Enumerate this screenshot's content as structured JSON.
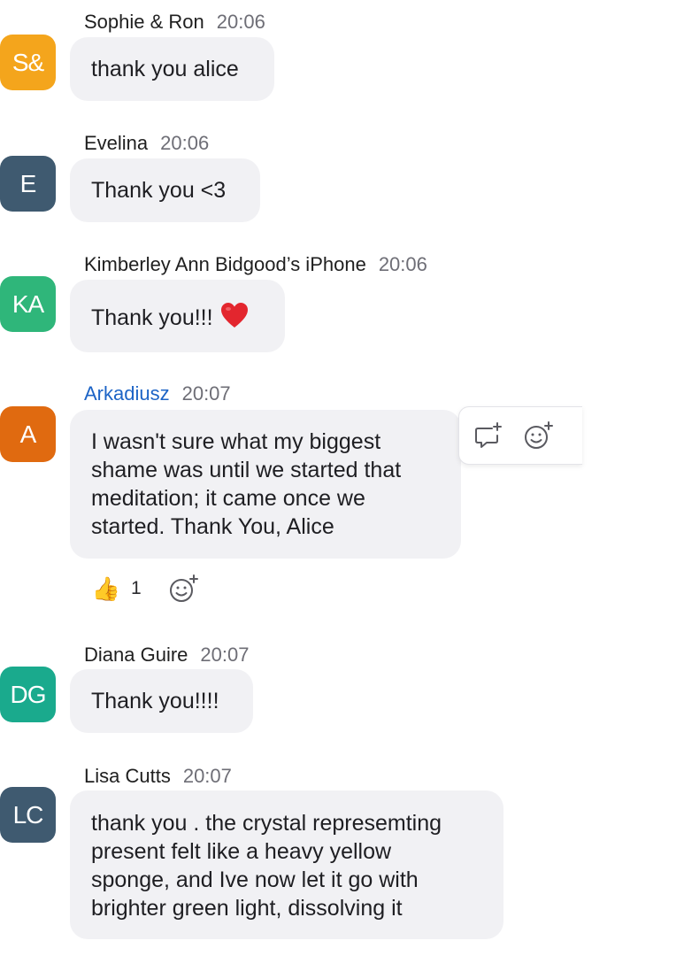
{
  "messages": [
    {
      "id": "m1",
      "initials": "S&",
      "avatar_color": "#f4a51c",
      "name": "Sophie & Ron",
      "name_color": "#1f1f1f",
      "time": "20:06",
      "lines": [
        "thank you alice"
      ]
    },
    {
      "id": "m2",
      "initials": "E",
      "avatar_color": "#3f5a70",
      "name": "Evelina",
      "name_color": "#1f1f1f",
      "time": "20:06",
      "lines": [
        "Thank you <3"
      ]
    },
    {
      "id": "m3",
      "initials": "KA",
      "avatar_color": "#2fb67a",
      "name": "Kimberley Ann Bidgood’s iPhone",
      "name_color": "#1f1f1f",
      "time": "20:06",
      "lines": [
        "Thank you!!!"
      ],
      "emoji": "heart-emoji"
    },
    {
      "id": "m4",
      "initials": "A",
      "avatar_color": "#e06a10",
      "name": "Arkadiusz",
      "name_color": "#1d64c6",
      "time": "20:07",
      "lines": [
        "I wasn't sure what my biggest",
        "shame was until we started that",
        "meditation; it came once we",
        "started. Thank You, Alice"
      ]
    },
    {
      "id": "m5",
      "initials": "DG",
      "avatar_color": "#1aaa8d",
      "name": "Diana Guire",
      "name_color": "#1f1f1f",
      "time": "20:07",
      "lines": [
        "Thank you!!!!"
      ]
    },
    {
      "id": "m6",
      "initials": "LC",
      "avatar_color": "#3f5a70",
      "name": "Lisa Cutts",
      "name_color": "#1f1f1f",
      "time": "20:07",
      "lines": [
        "thank you . the crystal represemting",
        "present felt like a heavy yellow",
        "sponge, and Ive now let it go with",
        "brighter green light, dissolving it"
      ]
    }
  ],
  "reactions": {
    "emoji": "👍",
    "count": "1",
    "add_icon": "add-reaction-icon"
  },
  "toolbar": {
    "reply_icon": "reply-in-thread-icon",
    "react_icon": "add-reaction-icon"
  }
}
